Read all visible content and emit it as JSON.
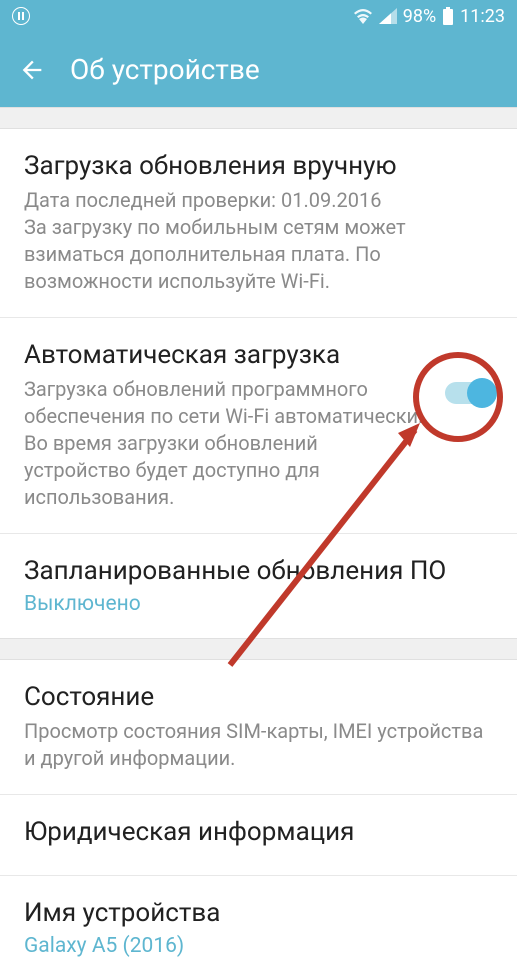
{
  "statusBar": {
    "battery": "98%",
    "time": "11:23"
  },
  "appBar": {
    "title": "Об устройстве"
  },
  "items": {
    "manualDownload": {
      "title": "Загрузка обновления вручную",
      "desc": "Дата последней проверки: 01.09.2016\nЗа загрузку по мобильным сетям может взиматься дополнительная плата. По возможности используйте Wi-Fi."
    },
    "autoDownload": {
      "title": "Автоматическая загрузка",
      "desc": "Загрузка обновлений программного обеспечения по сети Wi-Fi автоматически. Во время загрузки обновлений устройство будет доступно для использования."
    },
    "scheduled": {
      "title": "Запланированные обновления ПО",
      "link": "Выключено"
    },
    "status": {
      "title": "Состояние",
      "desc": "Просмотр состояния SIM-карты, IMEI устройства и другой информации."
    },
    "legal": {
      "title": "Юридическая информация"
    },
    "deviceName": {
      "title": "Имя устройства",
      "link": "Galaxy A5 (2016)"
    }
  }
}
